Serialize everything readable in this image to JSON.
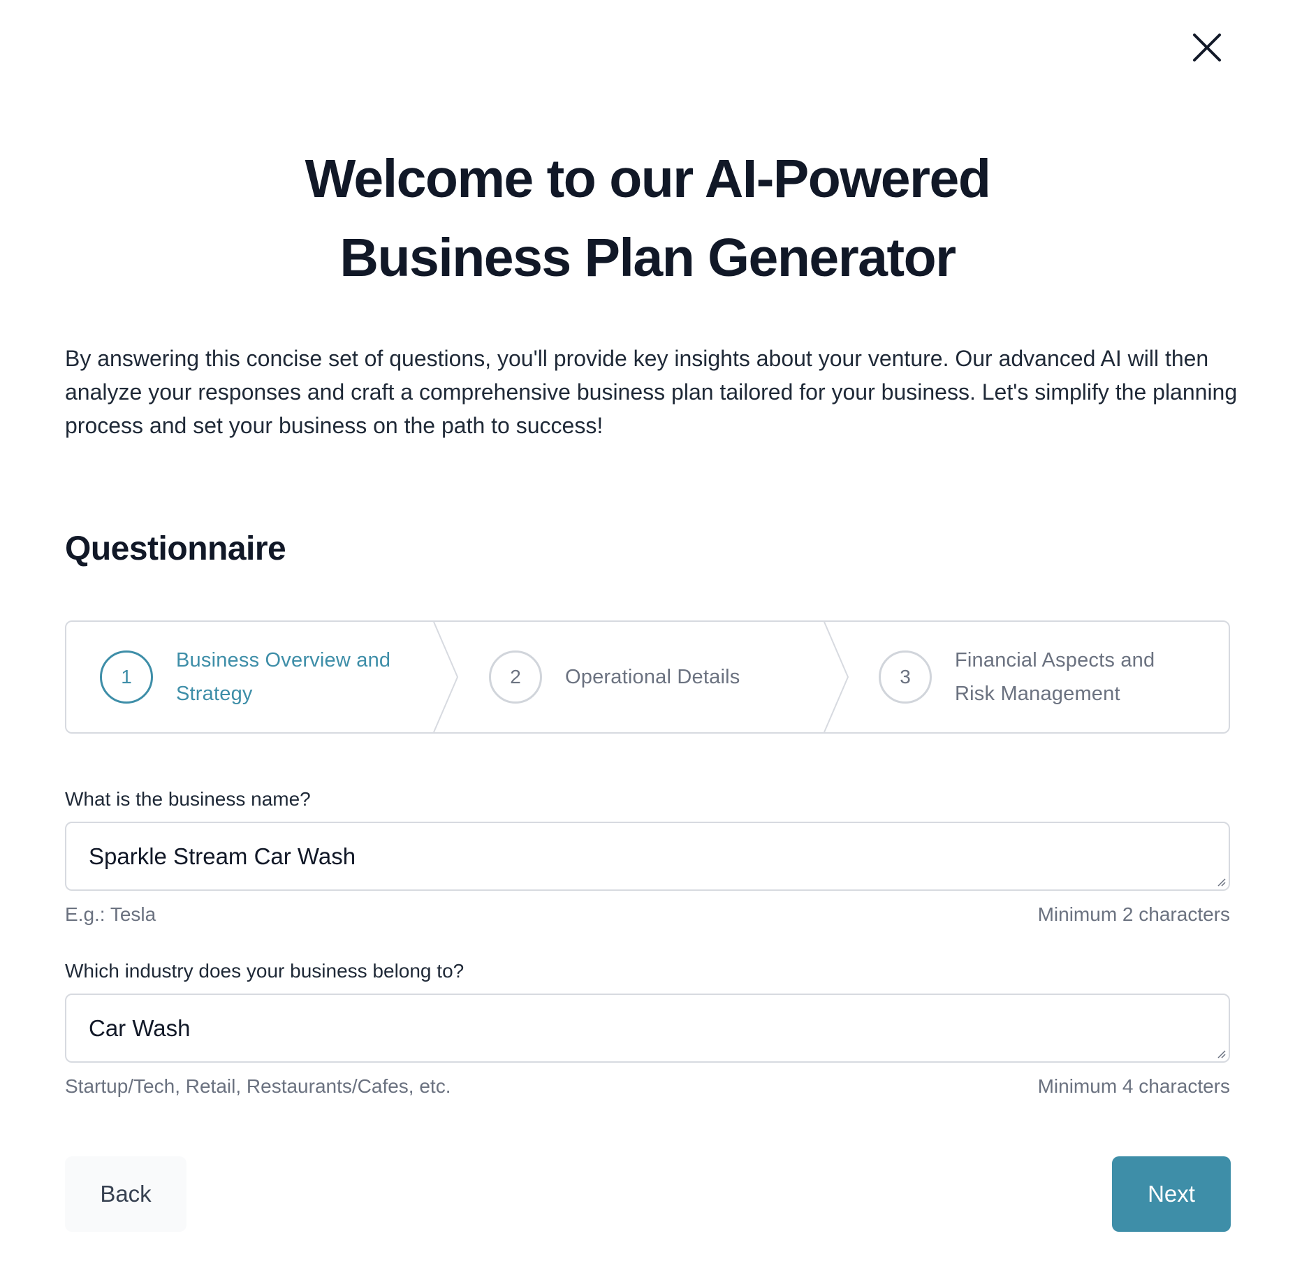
{
  "colors": {
    "accent": "#3e8ea8",
    "heading": "#111827",
    "muted": "#6b7280",
    "border": "#d7dae0"
  },
  "header": {
    "close_icon": "close-icon",
    "title_line1": "Welcome to our AI-Powered",
    "title_line2": "Business Plan Generator",
    "intro": "By answering this concise set of questions, you'll provide key insights about your venture. Our advanced AI will then analyze your responses and craft a comprehensive business plan tailored for your business. Let's simplify the planning process and set your business on the path to success!"
  },
  "questionnaire": {
    "heading": "Questionnaire",
    "steps": [
      {
        "number": "1",
        "label_line1": "Business Overview and",
        "label_line2": "Strategy",
        "state": "active"
      },
      {
        "number": "2",
        "label_line1": "Operational Details",
        "label_line2": "",
        "state": "inactive"
      },
      {
        "number": "3",
        "label_line1": "Financial Aspects and",
        "label_line2": "Risk Management",
        "state": "inactive"
      }
    ],
    "fields": [
      {
        "label": "What is the business name?",
        "value": "Sparkle Stream Car Wash",
        "hint_left": "E.g.: Tesla",
        "hint_right": "Minimum 2 characters"
      },
      {
        "label": "Which industry does your business belong to?",
        "value": "Car Wash",
        "hint_left": "Startup/Tech, Retail, Restaurants/Cafes, etc.",
        "hint_right": "Minimum 4 characters"
      }
    ]
  },
  "footer": {
    "back_label": "Back",
    "next_label": "Next"
  }
}
